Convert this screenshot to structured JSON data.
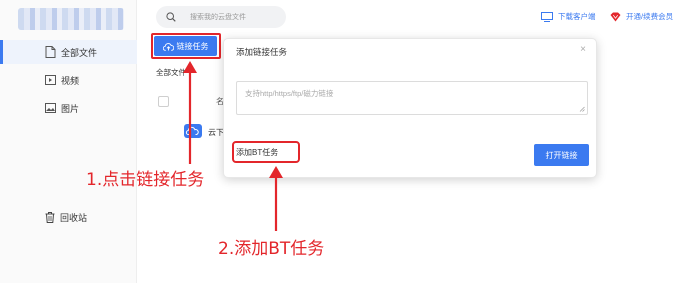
{
  "sidebar": {
    "items": [
      {
        "label": "全部文件",
        "icon": "document-icon"
      },
      {
        "label": "视频",
        "icon": "video-icon"
      },
      {
        "label": "图片",
        "icon": "image-icon"
      }
    ],
    "trash": {
      "label": "回收站",
      "icon": "trash-icon"
    }
  },
  "header": {
    "search_placeholder": "搜索我的云盘文件",
    "download_client": "下载客户端",
    "membership": "开通/续费会员"
  },
  "toolbar": {
    "link_task_label": "链接任务"
  },
  "main": {
    "breadcrumb": "全部文件",
    "column_name": "名",
    "row_name": "云下"
  },
  "modal": {
    "title": "添加链接任务",
    "close": "×",
    "input_placeholder": "支持http/https/ftp/磁力链接",
    "add_bt_label": "添加BT任务",
    "open_link_label": "打开链接"
  },
  "annotations": {
    "step1": "1.点击链接任务",
    "step2": "2.添加BT任务"
  },
  "colors": {
    "accent": "#3b7af0",
    "annotation_red": "#e3262b"
  }
}
